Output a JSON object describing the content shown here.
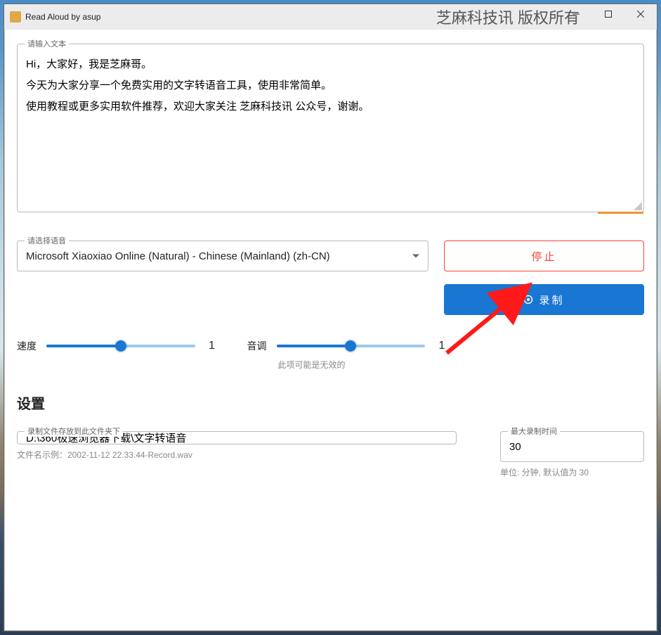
{
  "titlebar": {
    "app_title": "Read Aloud by asup",
    "copyright": "芝麻科技讯 版权所有"
  },
  "input": {
    "label": "请输入文本",
    "value": "Hi，大家好，我是芝麻哥。\n今天为大家分享一个免费实用的文字转语音工具，使用非常简单。\n使用教程或更多实用软件推荐，欢迎大家关注 芝麻科技讯 公众号，谢谢。"
  },
  "voice": {
    "label": "请选择语音",
    "value": "Microsoft Xiaoxiao Online (Natural) - Chinese (Mainland) (zh-CN)"
  },
  "buttons": {
    "stop": "停止",
    "record": "录制"
  },
  "sliders": {
    "speed_label": "速度",
    "speed_value": "1",
    "pitch_label": "音调",
    "pitch_value": "1",
    "pitch_note": "此项可能是无效的"
  },
  "settings": {
    "heading": "设置",
    "folder_label": "录制文件存放到此文件夹下",
    "folder_value": "D:\\360极速浏览器下载\\文字转语音",
    "filename_hint": "文件名示例：2002-11-12 22.33.44-Record.wav",
    "max_label": "最大录制时间",
    "max_value": "30",
    "max_hint": "单位: 分钟, 默认值为 30"
  }
}
